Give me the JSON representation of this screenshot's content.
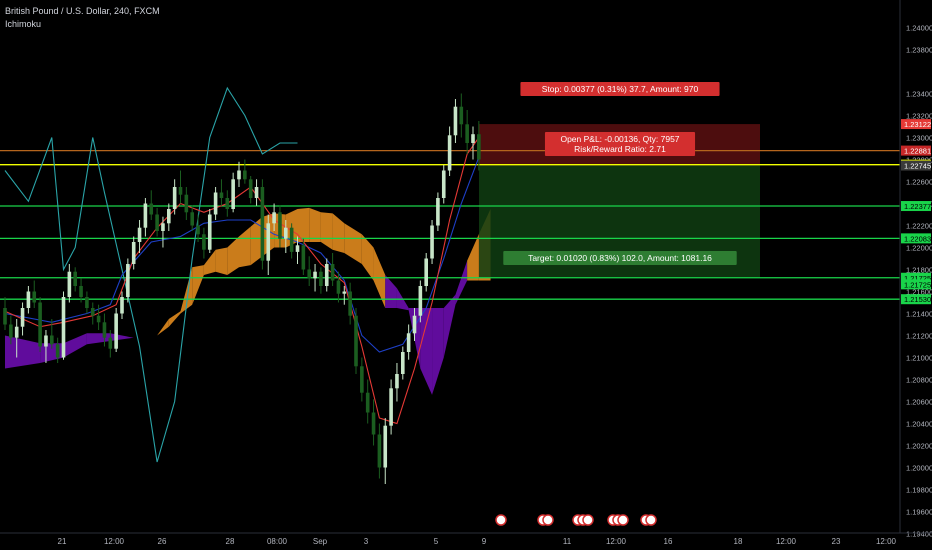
{
  "header": {
    "symbol_title": "British Pound / U.S. Dollar, 240, FXCM",
    "indicator": "Ichimoku"
  },
  "chart_data": {
    "type": "candlestick",
    "ylim": [
      1.1925,
      1.2425
    ],
    "y_ticks": [
      "1.24000",
      "1.23800",
      "1.23400",
      "1.23200",
      "1.23000",
      "1.22800",
      "1.22600",
      "1.22400",
      "1.22200",
      "1.22000",
      "1.21800",
      "1.21600",
      "1.21400",
      "1.21200",
      "1.21000",
      "1.20800",
      "1.20600",
      "1.20400",
      "1.20200",
      "1.20000",
      "1.19800",
      "1.19600",
      "1.19400"
    ],
    "x_ticks": [
      "21",
      "12:00",
      "26",
      "28",
      "08:00",
      "Sep",
      "3",
      "5",
      "9",
      "11",
      "12:00",
      "16",
      "18",
      "12:00",
      "23",
      "12:00"
    ],
    "colors": {
      "up": "#c8e6c9",
      "down": "#1b5e20",
      "tenkan": "#e53935",
      "kijun": "#1e40c8",
      "chikou": "#2aa4a8",
      "cloud_bull": "#e08a1e",
      "cloud_bear": "#6a0dad",
      "stop_zone": "#5a0f10",
      "target_zone": "#0f3d12",
      "h_green": "#19d44a",
      "h_yellow": "#f2ff00",
      "h_orange": "#b5651d"
    },
    "price_labels": [
      {
        "text": "1.23122",
        "value": 1.23122,
        "color": "#e53935"
      },
      {
        "text": "1.22881",
        "value": 1.22881,
        "color": "#c62828"
      },
      {
        "text": "1.22753",
        "value": 1.22753,
        "color": "#f2ff00"
      },
      {
        "text": "1.22745",
        "value": 1.22745,
        "color": "#3a3a3a"
      },
      {
        "text": "1.22377",
        "value": 1.22377,
        "color": "#19d44a"
      },
      {
        "text": "1.22083",
        "value": 1.22083,
        "color": "#19d44a"
      },
      {
        "text": "1.21725",
        "value": 1.21725,
        "color": "#19d44a"
      },
      {
        "text": "1.21725",
        "value": 1.21665,
        "color": "#19d44a"
      },
      {
        "text": "1.21530",
        "value": 1.2153,
        "color": "#19d44a"
      }
    ],
    "horizontal_lines": [
      {
        "value": 1.22881,
        "color": "#b5651d"
      },
      {
        "value": 1.22753,
        "color": "#f2ff00"
      },
      {
        "value": 1.22377,
        "color": "#19d44a"
      },
      {
        "value": 1.22083,
        "color": "#19d44a"
      },
      {
        "value": 1.21725,
        "color": "#19d44a"
      },
      {
        "value": 1.2153,
        "color": "#19d44a"
      }
    ],
    "position": {
      "entry": 1.22745,
      "stop": 1.23122,
      "target": 1.21725,
      "stop_label": "Stop: 0.00377 (0.31%) 37.7, Amount: 970",
      "pnl_label_line1": "Open P&L: -0.00136, Qty: 7957",
      "pnl_label_line2": "Risk/Reward Ratio: 2.71",
      "target_label": "Target: 0.01020 (0.83%) 102.0, Amount: 1081.16"
    },
    "candles": [
      [
        1.2145,
        1.2155,
        1.2125,
        1.213
      ],
      [
        1.213,
        1.2138,
        1.2112,
        1.2118
      ],
      [
        1.2118,
        1.2135,
        1.21,
        1.2128
      ],
      [
        1.2128,
        1.215,
        1.212,
        1.2145
      ],
      [
        1.2145,
        1.2165,
        1.214,
        1.216
      ],
      [
        1.216,
        1.217,
        1.2145,
        1.215
      ],
      [
        1.215,
        1.2155,
        1.2105,
        1.211
      ],
      [
        1.211,
        1.2125,
        1.2095,
        1.212
      ],
      [
        1.212,
        1.2135,
        1.2108,
        1.2112
      ],
      [
        1.2112,
        1.2118,
        1.2095,
        1.21
      ],
      [
        1.21,
        1.216,
        1.2098,
        1.2155
      ],
      [
        1.2155,
        1.2185,
        1.215,
        1.2178
      ],
      [
        1.2178,
        1.2182,
        1.216,
        1.2165
      ],
      [
        1.2165,
        1.2172,
        1.215,
        1.2155
      ],
      [
        1.2155,
        1.216,
        1.214,
        1.2145
      ],
      [
        1.2145,
        1.215,
        1.213,
        1.2138
      ],
      [
        1.2138,
        1.2148,
        1.2125,
        1.2132
      ],
      [
        1.2132,
        1.214,
        1.211,
        1.2118
      ],
      [
        1.2118,
        1.2125,
        1.21,
        1.2108
      ],
      [
        1.2108,
        1.2145,
        1.2105,
        1.214
      ],
      [
        1.214,
        1.216,
        1.2135,
        1.2155
      ],
      [
        1.2155,
        1.219,
        1.215,
        1.2185
      ],
      [
        1.2185,
        1.221,
        1.218,
        1.2205
      ],
      [
        1.2205,
        1.2225,
        1.2195,
        1.2218
      ],
      [
        1.2218,
        1.2245,
        1.221,
        1.224
      ],
      [
        1.224,
        1.2252,
        1.2225,
        1.223
      ],
      [
        1.223,
        1.2236,
        1.221,
        1.2215
      ],
      [
        1.2215,
        1.2228,
        1.22,
        1.2222
      ],
      [
        1.2222,
        1.224,
        1.2215,
        1.2235
      ],
      [
        1.2235,
        1.2262,
        1.223,
        1.2255
      ],
      [
        1.2255,
        1.227,
        1.224,
        1.2248
      ],
      [
        1.2248,
        1.2255,
        1.2225,
        1.2232
      ],
      [
        1.2232,
        1.2238,
        1.2215,
        1.222
      ],
      [
        1.222,
        1.223,
        1.2205,
        1.2212
      ],
      [
        1.2212,
        1.2218,
        1.219,
        1.2198
      ],
      [
        1.2198,
        1.2235,
        1.2195,
        1.223
      ],
      [
        1.223,
        1.2255,
        1.2225,
        1.225
      ],
      [
        1.225,
        1.2262,
        1.2238,
        1.2245
      ],
      [
        1.2245,
        1.2252,
        1.2228,
        1.2235
      ],
      [
        1.2235,
        1.2268,
        1.2232,
        1.2262
      ],
      [
        1.2262,
        1.2278,
        1.2255,
        1.227
      ],
      [
        1.227,
        1.228,
        1.2258,
        1.2262
      ],
      [
        1.2262,
        1.2265,
        1.224,
        1.2245
      ],
      [
        1.2245,
        1.2262,
        1.2238,
        1.2255
      ],
      [
        1.2255,
        1.2262,
        1.218,
        1.2188
      ],
      [
        1.2188,
        1.223,
        1.2175,
        1.2222
      ],
      [
        1.2222,
        1.224,
        1.2215,
        1.2232
      ],
      [
        1.2232,
        1.2238,
        1.22,
        1.2208
      ],
      [
        1.2208,
        1.2225,
        1.2195,
        1.2218
      ],
      [
        1.2218,
        1.2222,
        1.219,
        1.2196
      ],
      [
        1.2196,
        1.221,
        1.2185,
        1.2202
      ],
      [
        1.2202,
        1.2208,
        1.2175,
        1.218
      ],
      [
        1.218,
        1.2192,
        1.2165,
        1.2172
      ],
      [
        1.2172,
        1.2185,
        1.216,
        1.2178
      ],
      [
        1.2178,
        1.2182,
        1.2158,
        1.2165
      ],
      [
        1.2165,
        1.219,
        1.216,
        1.2185
      ],
      [
        1.2185,
        1.2195,
        1.2165,
        1.217
      ],
      [
        1.217,
        1.2178,
        1.215,
        1.2158
      ],
      [
        1.2158,
        1.2165,
        1.2148,
        1.216
      ],
      [
        1.216,
        1.2168,
        1.213,
        1.2138
      ],
      [
        1.2138,
        1.2145,
        1.2085,
        1.2092
      ],
      [
        1.2092,
        1.21,
        1.206,
        1.2068
      ],
      [
        1.2068,
        1.208,
        1.204,
        1.205
      ],
      [
        1.205,
        1.2062,
        1.202,
        1.203
      ],
      [
        1.203,
        1.204,
        1.199,
        1.2
      ],
      [
        1.2,
        1.2045,
        1.1985,
        1.2038
      ],
      [
        1.2038,
        1.208,
        1.203,
        1.2072
      ],
      [
        1.2072,
        1.2095,
        1.206,
        1.2085
      ],
      [
        1.2085,
        1.211,
        1.208,
        1.2105
      ],
      [
        1.2105,
        1.213,
        1.2098,
        1.2122
      ],
      [
        1.2122,
        1.2145,
        1.2115,
        1.2138
      ],
      [
        1.2138,
        1.217,
        1.2132,
        1.2165
      ],
      [
        1.2165,
        1.2195,
        1.216,
        1.219
      ],
      [
        1.219,
        1.2225,
        1.2185,
        1.222
      ],
      [
        1.222,
        1.225,
        1.2215,
        1.2245
      ],
      [
        1.2245,
        1.2275,
        1.224,
        1.227
      ],
      [
        1.227,
        1.231,
        1.2265,
        1.2302
      ],
      [
        1.2302,
        1.2335,
        1.2295,
        1.2328
      ],
      [
        1.2328,
        1.234,
        1.23,
        1.2312
      ],
      [
        1.2312,
        1.2325,
        1.2285,
        1.2295
      ],
      [
        1.2295,
        1.231,
        1.228,
        1.2303
      ],
      [
        1.2303,
        1.2315,
        1.227,
        1.228
      ]
    ],
    "tenkan": [
      [
        0,
        1.2142
      ],
      [
        6,
        1.2128
      ],
      [
        10,
        1.2132
      ],
      [
        15,
        1.2138
      ],
      [
        19,
        1.2148
      ],
      [
        22,
        1.219
      ],
      [
        26,
        1.2218
      ],
      [
        30,
        1.224
      ],
      [
        34,
        1.2232
      ],
      [
        38,
        1.224
      ],
      [
        42,
        1.2255
      ],
      [
        46,
        1.2225
      ],
      [
        50,
        1.2212
      ],
      [
        54,
        1.2185
      ],
      [
        58,
        1.2168
      ],
      [
        61,
        1.211
      ],
      [
        64,
        1.2045
      ],
      [
        67,
        1.204
      ],
      [
        70,
        1.209
      ],
      [
        73,
        1.215
      ],
      [
        76,
        1.2225
      ],
      [
        79,
        1.2285
      ],
      [
        81,
        1.23
      ]
    ],
    "kijun": [
      [
        0,
        1.214
      ],
      [
        8,
        1.2132
      ],
      [
        14,
        1.214
      ],
      [
        18,
        1.2148
      ],
      [
        20,
        1.2175
      ],
      [
        25,
        1.2205
      ],
      [
        30,
        1.221
      ],
      [
        34,
        1.2222
      ],
      [
        38,
        1.2225
      ],
      [
        42,
        1.2225
      ],
      [
        46,
        1.2212
      ],
      [
        50,
        1.2205
      ],
      [
        54,
        1.2195
      ],
      [
        58,
        1.217
      ],
      [
        61,
        1.212
      ],
      [
        64,
        1.2105
      ],
      [
        68,
        1.2112
      ],
      [
        72,
        1.2145
      ],
      [
        75,
        1.219
      ],
      [
        78,
        1.224
      ],
      [
        81,
        1.2282
      ]
    ],
    "chikou": [
      [
        0,
        1.227
      ],
      [
        4,
        1.2242
      ],
      [
        8,
        1.23
      ],
      [
        10,
        1.218
      ],
      [
        12,
        1.22
      ],
      [
        15,
        1.23
      ],
      [
        17,
        1.225
      ],
      [
        20,
        1.218
      ],
      [
        23,
        1.211
      ],
      [
        26,
        1.2005
      ],
      [
        29,
        1.206
      ],
      [
        32,
        1.219
      ],
      [
        35,
        1.23
      ],
      [
        38,
        1.2345
      ],
      [
        41,
        1.232
      ],
      [
        44,
        1.2285
      ],
      [
        47,
        1.2295
      ],
      [
        50,
        1.2295
      ]
    ],
    "cloud_top": [
      [
        0,
        1.212
      ],
      [
        6,
        1.2113
      ],
      [
        10,
        1.2113
      ],
      [
        14,
        1.2122
      ],
      [
        18,
        1.2122
      ],
      [
        22,
        1.2118
      ],
      [
        26,
        1.212
      ],
      [
        28,
        1.2135
      ],
      [
        30,
        1.2142
      ],
      [
        32,
        1.2182
      ],
      [
        34,
        1.2184
      ],
      [
        36,
        1.2198
      ],
      [
        38,
        1.22
      ],
      [
        40,
        1.221
      ],
      [
        42,
        1.2219
      ],
      [
        44,
        1.2228
      ],
      [
        46,
        1.2231
      ],
      [
        48,
        1.223
      ],
      [
        50,
        1.2235
      ],
      [
        52,
        1.2236
      ],
      [
        54,
        1.2232
      ],
      [
        56,
        1.2231
      ],
      [
        58,
        1.2222
      ],
      [
        61,
        1.2212
      ],
      [
        63,
        1.22
      ],
      [
        65,
        1.2175
      ],
      [
        67,
        1.2163
      ],
      [
        69,
        1.2143
      ],
      [
        71,
        1.209
      ],
      [
        73,
        1.2066
      ],
      [
        75,
        1.21
      ],
      [
        77,
        1.2148
      ],
      [
        79,
        1.2188
      ],
      [
        81,
        1.2212
      ],
      [
        83,
        1.2235
      ]
    ],
    "cloud_bottom": [
      [
        0,
        1.209
      ],
      [
        6,
        1.2095
      ],
      [
        10,
        1.21
      ],
      [
        14,
        1.2112
      ],
      [
        18,
        1.2115
      ],
      [
        22,
        1.2118
      ],
      [
        26,
        1.212
      ],
      [
        28,
        1.2128
      ],
      [
        30,
        1.214
      ],
      [
        32,
        1.2148
      ],
      [
        34,
        1.2175
      ],
      [
        36,
        1.2178
      ],
      [
        38,
        1.2175
      ],
      [
        40,
        1.2182
      ],
      [
        42,
        1.2184
      ],
      [
        44,
        1.2192
      ],
      [
        46,
        1.22
      ],
      [
        48,
        1.22
      ],
      [
        50,
        1.2205
      ],
      [
        52,
        1.2205
      ],
      [
        54,
        1.2205
      ],
      [
        56,
        1.2198
      ],
      [
        58,
        1.2195
      ],
      [
        61,
        1.2185
      ],
      [
        63,
        1.217
      ],
      [
        65,
        1.2145
      ],
      [
        67,
        1.2145
      ],
      [
        69,
        1.2145
      ],
      [
        71,
        1.2145
      ],
      [
        73,
        1.2145
      ],
      [
        75,
        1.2145
      ],
      [
        77,
        1.2157
      ],
      [
        79,
        1.217
      ],
      [
        81,
        1.217
      ],
      [
        83,
        1.217
      ]
    ]
  }
}
